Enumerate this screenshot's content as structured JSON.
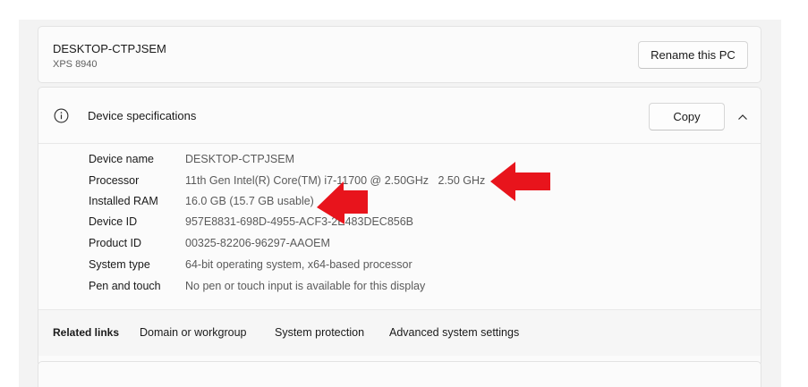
{
  "pc": {
    "name": "DESKTOP-CTPJSEM",
    "model": "XPS 8940",
    "rename_label": "Rename this PC"
  },
  "specs": {
    "title": "Device specifications",
    "copy_label": "Copy",
    "rows": [
      {
        "label": "Device name",
        "value": "DESKTOP-CTPJSEM"
      },
      {
        "label": "Processor",
        "value": "11th Gen Intel(R) Core(TM) i7-11700 @ 2.50GHz   2.50 GHz"
      },
      {
        "label": "Installed RAM",
        "value": "16.0 GB (15.7 GB usable)"
      },
      {
        "label": "Device ID",
        "value": "957E8831-698D-4955-ACF3-2E483DEC856B"
      },
      {
        "label": "Product ID",
        "value": "00325-82206-96297-AAOEM"
      },
      {
        "label": "System type",
        "value": "64-bit operating system, x64-based processor"
      },
      {
        "label": "Pen and touch",
        "value": "No pen or touch input is available for this display"
      }
    ]
  },
  "related": {
    "title": "Related links",
    "links": [
      "Domain or workgroup",
      "System protection",
      "Advanced system settings"
    ]
  },
  "icons": {
    "info": "info-icon",
    "chevron": "chevron-up-icon",
    "annotation": "red-arrow-icon"
  },
  "colors": {
    "annotation_arrow": "#e8141c",
    "pane_background": "#f3f3f3",
    "card_background": "#fbfbfb"
  }
}
